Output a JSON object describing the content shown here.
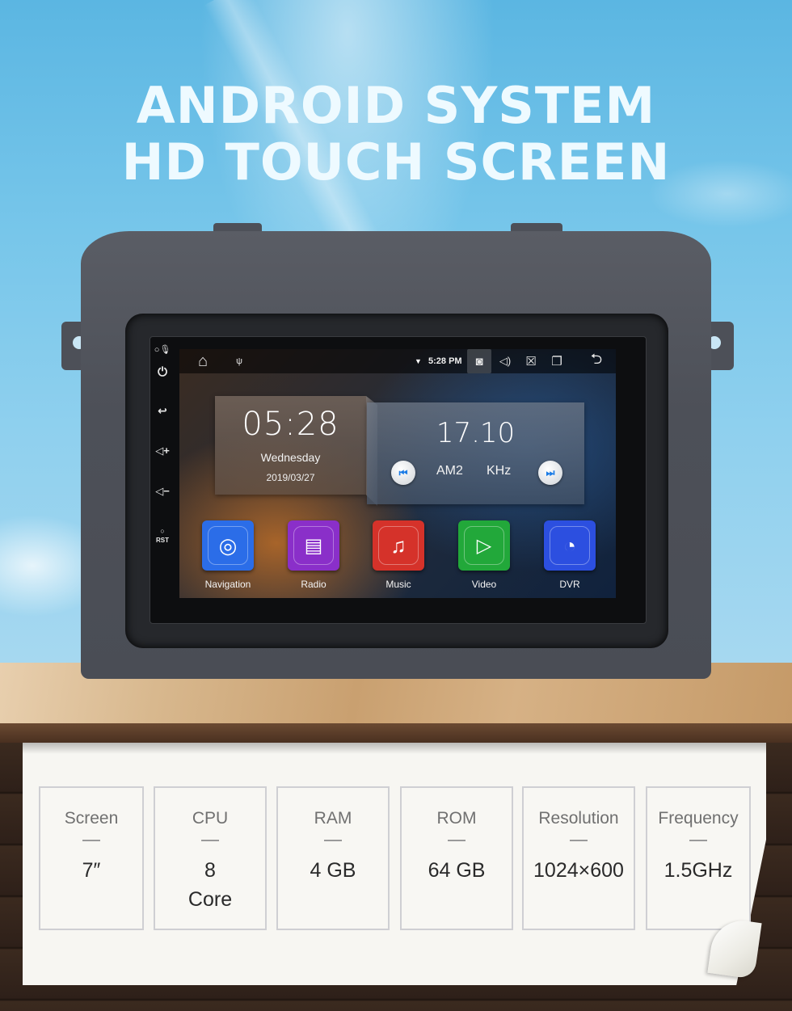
{
  "headline": {
    "line1": "ANDROID SYSTEM",
    "line2": "HD TOUCH SCREEN"
  },
  "hardware_buttons": [
    {
      "name": "mic",
      "glyph": "🎙"
    },
    {
      "name": "power",
      "glyph": "⏻"
    },
    {
      "name": "back",
      "glyph": "↩"
    },
    {
      "name": "volume-up",
      "glyph": "◁+"
    },
    {
      "name": "volume-down",
      "glyph": "◁−"
    },
    {
      "name": "reset",
      "label": "RST"
    }
  ],
  "status_bar": {
    "home_icon": "⌂",
    "usb_icon": "ψ",
    "wifi_icon": "▼",
    "time": "5:28 PM",
    "screenshot_icon": "◙",
    "volume_icon": "◁)",
    "close_icon": "☒",
    "recents_icon": "❐",
    "back_icon": "⮌"
  },
  "clock_widget": {
    "time": "05:28",
    "day": "Wednesday",
    "date": "2019/03/27"
  },
  "radio_widget": {
    "frequency": "17.10",
    "band": "AM2",
    "unit": "KHz",
    "prev_icon": "⏮",
    "next_icon": "⏭"
  },
  "apps": [
    {
      "label": "Navigation",
      "color": "#2b6de8",
      "icon": "◎"
    },
    {
      "label": "Radio",
      "color": "#8a2fc9",
      "icon": "▤"
    },
    {
      "label": "Music",
      "color": "#d5322a",
      "icon": "♫"
    },
    {
      "label": "Video",
      "color": "#22a83a",
      "icon": "▷"
    },
    {
      "label": "DVR",
      "color": "#2c4fe0",
      "icon": "◔"
    }
  ],
  "specs": [
    {
      "label": "Screen",
      "value": "7″"
    },
    {
      "label": "CPU",
      "value": "8\nCore"
    },
    {
      "label": "RAM",
      "value": "4 GB"
    },
    {
      "label": "ROM",
      "value": "64 GB"
    },
    {
      "label": "Resolution",
      "value": "1024×600"
    },
    {
      "label": "Frequency",
      "value": "1.5GHz"
    }
  ]
}
